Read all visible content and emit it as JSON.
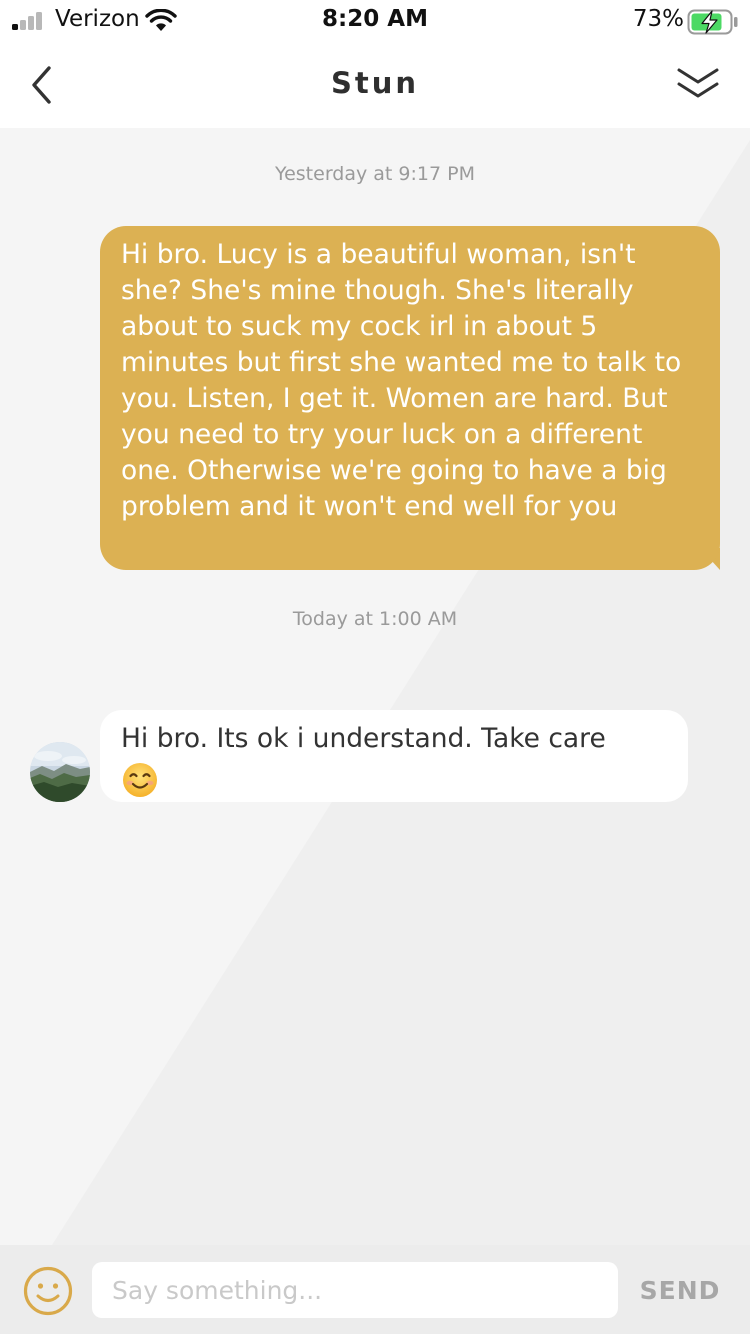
{
  "status_bar": {
    "carrier": "Verizon",
    "time": "8:20 AM",
    "battery_percent": "73%"
  },
  "header": {
    "title": "Stun",
    "back_icon": "chevron-left-icon",
    "collapse_icon": "double-chevron-down-icon"
  },
  "conversation": {
    "timestamp_1": "Yesterday at 9:17 PM",
    "outgoing_message": "Hi bro. Lucy is a beautiful woman, isn't she? She's mine though. She's literally about to suck my cock irl in about 5 minutes but first she wanted me to talk to you. Listen, I get it. Women are hard. But you need to try your luck on a different one. Otherwise we're going to have a big problem and it won't end well for you",
    "timestamp_2": "Today at 1:00 AM",
    "incoming_message": "Hi bro. Its ok i understand. Take care",
    "incoming_emoji": "smiling-face-icon"
  },
  "composer": {
    "placeholder": "Say something...",
    "send_label": "SEND",
    "emoji_icon": "smiley-icon"
  },
  "colors": {
    "outgoing_bubble": "#dcb153",
    "incoming_bubble": "#ffffff",
    "background": "#efefef",
    "accent_icon": "#d9a94a"
  }
}
